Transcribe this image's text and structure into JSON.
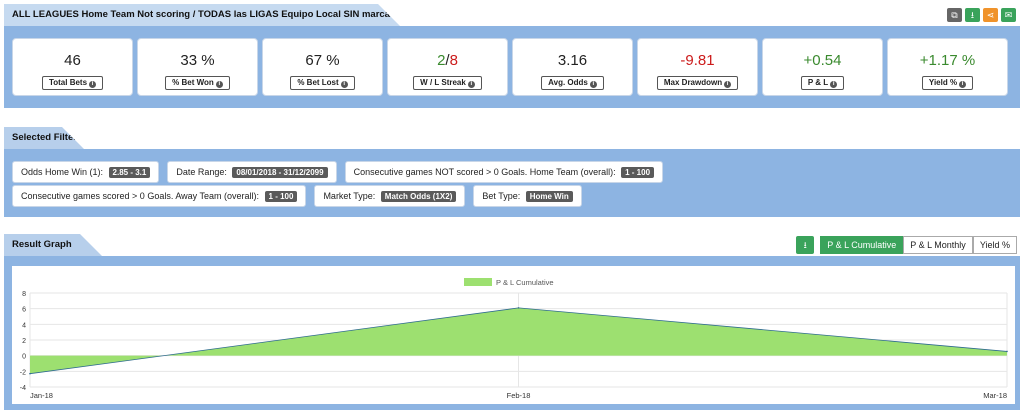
{
  "header": {
    "title": "ALL LEAGUES Home Team Not scoring / TODAS las LIGAS Equipo Local SIN marcar",
    "actions": [
      {
        "icon": "copy-icon",
        "glyph": "⧉",
        "color": "gray"
      },
      {
        "icon": "download-icon",
        "glyph": "⭳",
        "color": "green"
      },
      {
        "icon": "share-icon",
        "glyph": "⋖",
        "color": "orange"
      },
      {
        "icon": "email-icon",
        "glyph": "✉",
        "color": "green"
      }
    ]
  },
  "stats": [
    {
      "value": "46",
      "label": "Total Bets",
      "tone": ""
    },
    {
      "value": "33 %",
      "label": "% Bet Won",
      "tone": ""
    },
    {
      "value": "67 %",
      "label": "% Bet Lost",
      "tone": ""
    },
    {
      "value_a": "2",
      "value_sep": "/",
      "value_b": "8",
      "label": "W / L Streak",
      "tone": "streak"
    },
    {
      "value": "3.16",
      "label": "Avg. Odds",
      "tone": ""
    },
    {
      "value": "-9.81",
      "label": "Max Drawdown",
      "tone": "red"
    },
    {
      "value": "+0.54",
      "label": "P & L",
      "tone": "green"
    },
    {
      "value": "+1.17 %",
      "label": "Yield %",
      "tone": "green"
    }
  ],
  "filters": {
    "title": "Selected Filters",
    "row1": [
      {
        "label": "Odds Home Win (1):",
        "value": "2.85 - 3.1"
      },
      {
        "label": "Date Range:",
        "value": "08/01/2018 - 31/12/2099"
      },
      {
        "label": "Consecutive games NOT scored > 0 Goals. Home Team (overall):",
        "value": "1 - 100"
      }
    ],
    "row2": [
      {
        "label": "Consecutive games scored > 0 Goals. Away Team (overall):",
        "value": "1 - 100"
      },
      {
        "label": "Market Type:",
        "value": "Match Odds (1X2)"
      },
      {
        "label": "Bet Type:",
        "value": "Home Win"
      }
    ]
  },
  "graph": {
    "title": "Result Graph",
    "download_icon": "download-icon",
    "tabs": [
      {
        "label": "P & L Cumulative",
        "active": true
      },
      {
        "label": "P & L Monthly",
        "active": false
      },
      {
        "label": "Yield %",
        "active": false
      }
    ]
  },
  "colors": {
    "accent_green": "#3aa35b",
    "band_blue": "#8db4e2",
    "area_fill": "#9de070"
  },
  "chart_data": {
    "type": "area",
    "categories": [
      "Jan-18",
      "Feb-18",
      "Mar-18"
    ],
    "series": [
      {
        "name": "P & L Cumulative",
        "values": [
          -2.3,
          6.1,
          0.54
        ]
      }
    ],
    "ylim": [
      -4,
      8
    ],
    "yticks": [
      -4,
      -2,
      0,
      2,
      4,
      6,
      8
    ],
    "legend": "top-center",
    "grid": true
  }
}
